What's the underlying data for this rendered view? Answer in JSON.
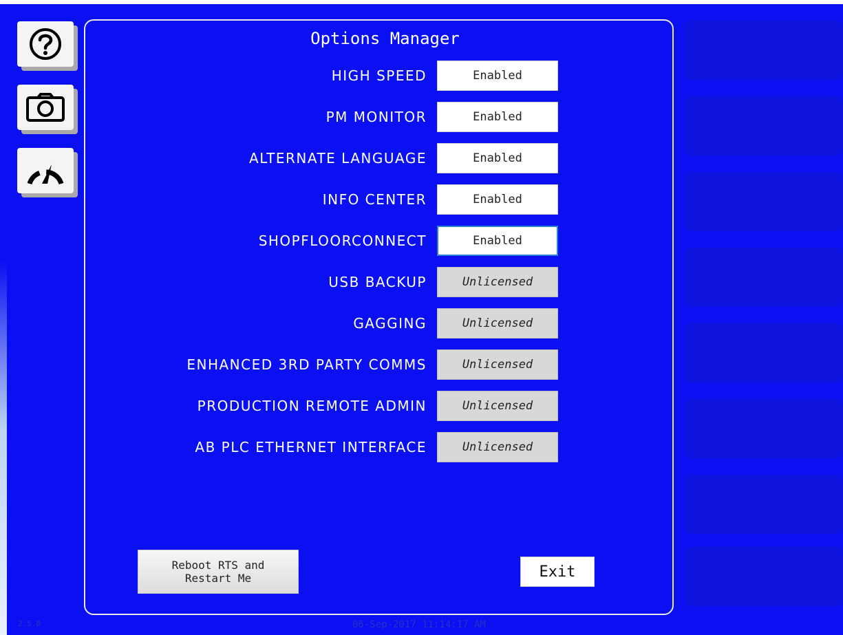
{
  "window": {
    "title": "Options Manager",
    "version": "2.5.8",
    "datetime": "06-Sep-2017 11:14:17 AM"
  },
  "side_buttons": [
    {
      "name": "help-button",
      "icon": "question-icon"
    },
    {
      "name": "screenshot-button",
      "icon": "camera-icon"
    },
    {
      "name": "gauge-button",
      "icon": "gauge-icon"
    }
  ],
  "options": [
    {
      "label": "HIGH SPEED",
      "status": "Enabled"
    },
    {
      "label": "PM MONITOR",
      "status": "Enabled"
    },
    {
      "label": "ALTERNATE LANGUAGE",
      "status": "Enabled"
    },
    {
      "label": "INFO CENTER",
      "status": "Enabled"
    },
    {
      "label": "SHOPFLOORCONNECT",
      "status": "Enabled"
    },
    {
      "label": "USB BACKUP",
      "status": "Unlicensed"
    },
    {
      "label": "GAGGING",
      "status": "Unlicensed"
    },
    {
      "label": "ENHANCED 3RD PARTY COMMS",
      "status": "Unlicensed"
    },
    {
      "label": "PRODUCTION REMOTE ADMIN",
      "status": "Unlicensed"
    },
    {
      "label": "AB PLC ETHERNET INTERFACE",
      "status": "Unlicensed"
    }
  ],
  "buttons": {
    "reboot_label": "Reboot RTS and\nRestart Me",
    "exit_label": "Exit"
  },
  "colors": {
    "background": "#0a10f2",
    "panel_border": "#e8e8e8",
    "enabled_bg": "#ffffff",
    "unlicensed_bg": "#d8d8d8",
    "focus_border": "#2a7fd6"
  }
}
